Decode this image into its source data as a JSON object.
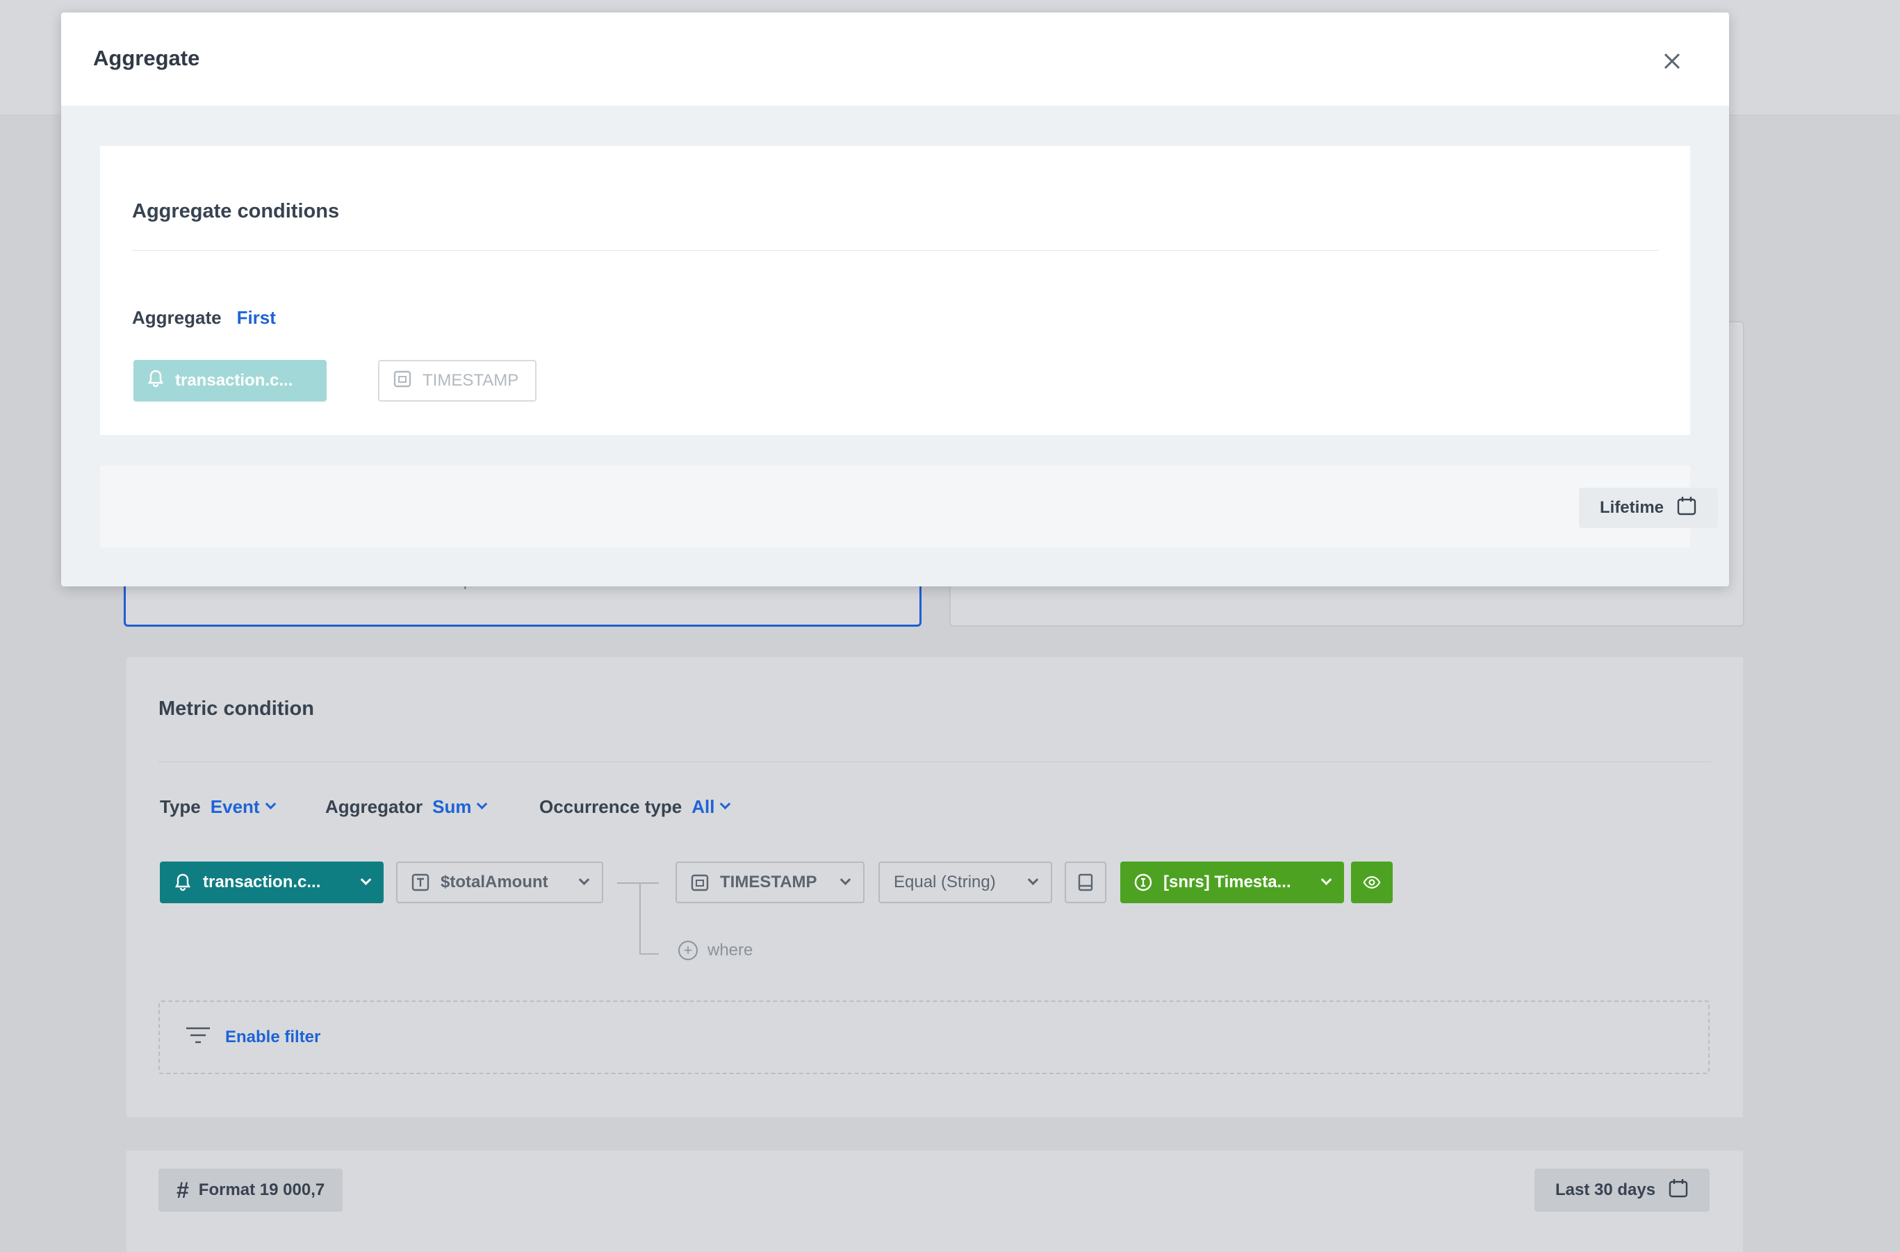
{
  "modal": {
    "title": "Aggregate",
    "close_icon": "close-icon",
    "conditions": {
      "title": "Aggregate conditions",
      "aggregate_label": "Aggregate",
      "aggregate_value": "First",
      "event_chip": "transaction.c...",
      "timestamp_chip": "TIMESTAMP"
    },
    "footer": {
      "lifetime_label": "Lifetime"
    }
  },
  "background": {
    "left_card_text": "profile attributes",
    "metric": {
      "title": "Metric condition",
      "type_label": "Type",
      "type_value": "Event",
      "aggregator_label": "Aggregator",
      "aggregator_value": "Sum",
      "occurrence_label": "Occurrence type",
      "occurrence_value": "All",
      "event_chip": "transaction.c...",
      "param_chip": "$totalAmount",
      "timestamp_chip": "TIMESTAMP",
      "operator_chip": "Equal (String)",
      "value_chip": "[snrs] Timesta...",
      "where_label": "where",
      "filter_label": "Enable filter"
    },
    "bottom": {
      "format_label": "Format 19 000,7",
      "range_label": "Last 30 days"
    }
  },
  "colors": {
    "accent_blue": "#1e63d6",
    "teal": "#0f7e82",
    "green": "#4da321",
    "teal_light": "#a3d8d8"
  }
}
